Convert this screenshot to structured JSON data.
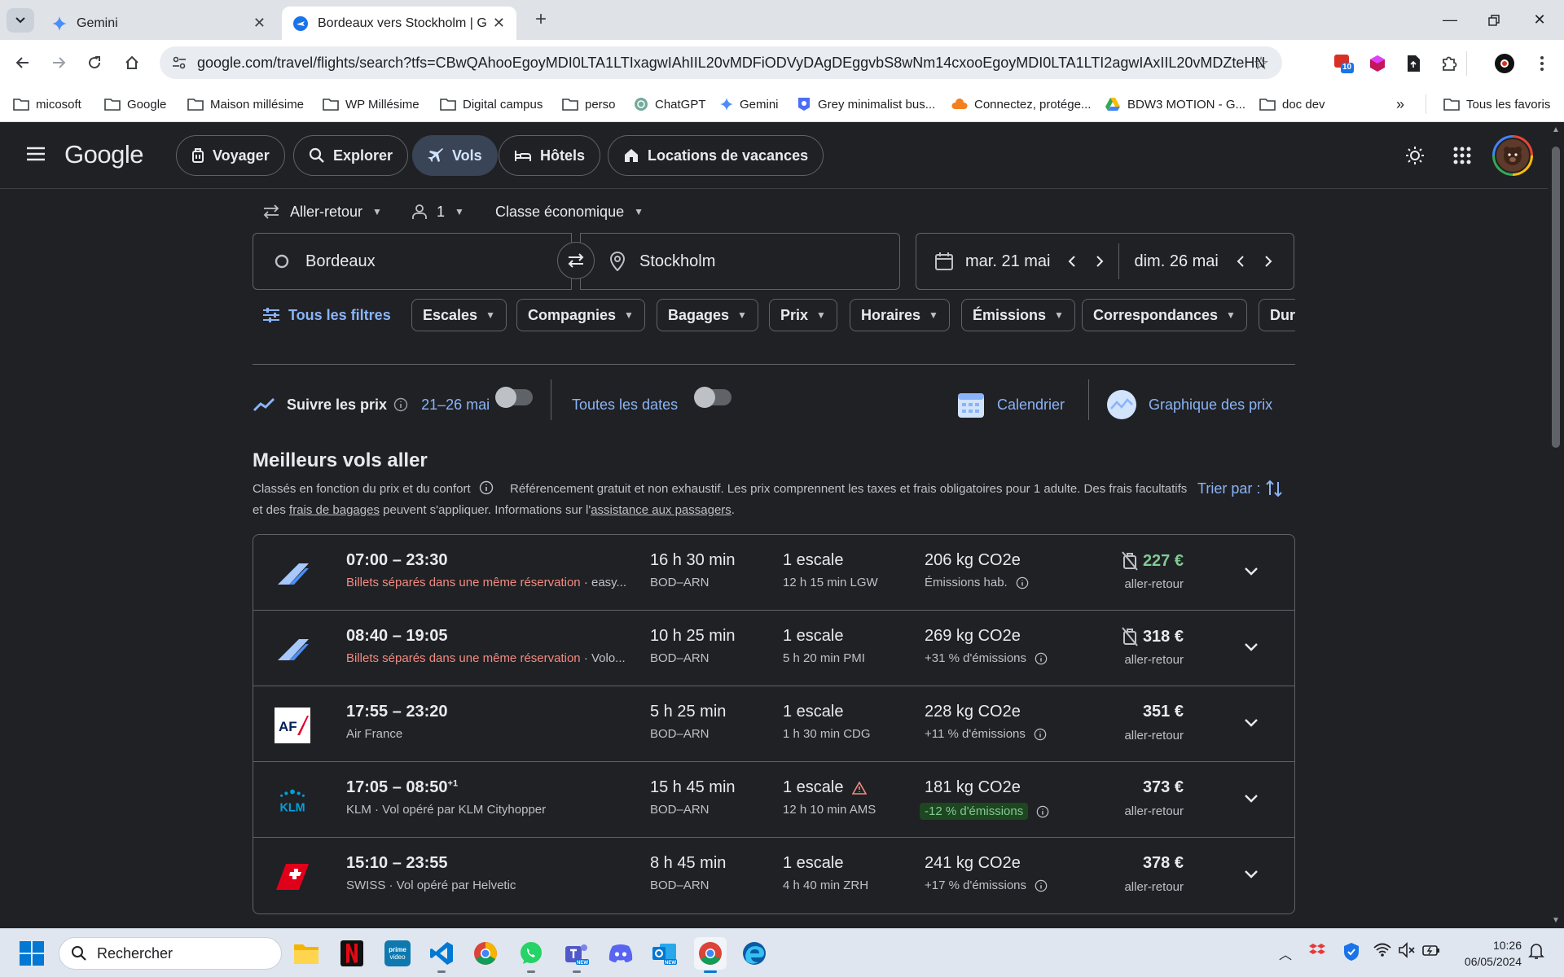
{
  "browser": {
    "tabs": [
      {
        "title": "Gemini",
        "active": false
      },
      {
        "title": "Bordeaux vers Stockholm | Goo",
        "active": true
      }
    ],
    "url": "google.com/travel/flights/search?tfs=CBwQAhooEgoyMDI0LTA1LTIxagwIAhIIL20vMDFiODVyDAgDEggvbS8wNm14cxooEgoyMDI0LTA1LTI2agwIAxIIL20vMDZteHNyDAgCE...",
    "extension_badge": "10",
    "bookmarks": [
      "micosoft",
      "Google",
      "Maison millésime",
      "WP Millésime",
      "Digital campus",
      "perso",
      "ChatGPT",
      "Gemini",
      "Grey minimalist bus...",
      "Connectez, protége...",
      "BDW3 MOTION - G...",
      "doc dev"
    ],
    "all_bookmarks": "Tous les favoris"
  },
  "header": {
    "logo": "Google",
    "nav": [
      "Voyager",
      "Explorer",
      "Vols",
      "Hôtels",
      "Locations de vacances"
    ],
    "active_nav": "Vols"
  },
  "search": {
    "trip_type": "Aller-retour",
    "passengers": "1",
    "cabin_class": "Classe économique",
    "origin": "Bordeaux",
    "destination": "Stockholm",
    "depart_date": "mar. 21 mai",
    "return_date": "dim. 26 mai"
  },
  "filters": {
    "all": "Tous les filtres",
    "chips": [
      "Escales",
      "Compagnies",
      "Bagages",
      "Prix",
      "Horaires",
      "Émissions",
      "Correspondances",
      "Duré"
    ]
  },
  "tracking": {
    "label": "Suivre les prix",
    "dates": "21–26 mai",
    "all_dates": "Toutes les dates",
    "calendar": "Calendrier",
    "price_graph": "Graphique des prix"
  },
  "results": {
    "title": "Meilleurs vols aller",
    "subtitle_ranked": "Classés en fonction du prix et du confort",
    "subtitle_text": "Référencement gratuit et non exhaustif. Les prix comprennent les taxes et frais obligatoires pour 1 adulte. Des frais facultatifs et des",
    "link_baggage": "frais de bagages",
    "subtitle_mid": "peuvent s'appliquer. Informations sur l'",
    "link_assistance": "assistance aux passagers",
    "subtitle_end": ".",
    "sort_label": "Trier par :",
    "flights": [
      {
        "times": "07:00 – 23:30",
        "plus_day": "",
        "airline_warn": "Billets séparés dans une même réservation",
        "airline": " · easy...",
        "duration": "16 h 30 min",
        "route": "BOD–ARN",
        "stops": "1 escale",
        "stop_warning": false,
        "layover": "12 h 15 min LGW",
        "co2": "206 kg CO2e",
        "emissions": "Émissions hab.",
        "emissions_badge": false,
        "price": "227 €",
        "price_green": true,
        "no_bag_icon": true,
        "price_type": "aller-retour",
        "logo": "plane-tail"
      },
      {
        "times": "08:40 – 19:05",
        "plus_day": "",
        "airline_warn": "Billets séparés dans une même réservation",
        "airline": " · Volo...",
        "duration": "10 h 25 min",
        "route": "BOD–ARN",
        "stops": "1 escale",
        "stop_warning": false,
        "layover": "5 h 20 min PMI",
        "co2": "269 kg CO2e",
        "emissions": "+31 % d'émissions",
        "emissions_badge": false,
        "price": "318 €",
        "price_green": false,
        "no_bag_icon": true,
        "price_type": "aller-retour",
        "logo": "plane-tail"
      },
      {
        "times": "17:55 – 23:20",
        "plus_day": "",
        "airline_warn": "",
        "airline": "Air France",
        "duration": "5 h 25 min",
        "route": "BOD–ARN",
        "stops": "1 escale",
        "stop_warning": false,
        "layover": "1 h 30 min CDG",
        "co2": "228 kg CO2e",
        "emissions": "+11 % d'émissions",
        "emissions_badge": false,
        "price": "351 €",
        "price_green": false,
        "no_bag_icon": false,
        "price_type": "aller-retour",
        "logo": "af"
      },
      {
        "times": "17:05 – 08:50",
        "plus_day": "+1",
        "airline_warn": "",
        "airline": "KLM · Vol opéré par KLM Cityhopper",
        "duration": "15 h 45 min",
        "route": "BOD–ARN",
        "stops": "1 escale",
        "stop_warning": true,
        "layover": "12 h 10 min AMS",
        "co2": "181 kg CO2e",
        "emissions": "-12 % d'émissions",
        "emissions_badge": true,
        "price": "373 €",
        "price_green": false,
        "no_bag_icon": false,
        "price_type": "aller-retour",
        "logo": "klm"
      },
      {
        "times": "15:10 – 23:55",
        "plus_day": "",
        "airline_warn": "",
        "airline": "SWISS · Vol opéré par Helvetic",
        "duration": "8 h 45 min",
        "route": "BOD–ARN",
        "stops": "1 escale",
        "stop_warning": false,
        "layover": "4 h 40 min ZRH",
        "co2": "241 kg CO2e",
        "emissions": "+17 % d'émissions",
        "emissions_badge": false,
        "price": "378 €",
        "price_green": false,
        "no_bag_icon": false,
        "price_type": "aller-retour",
        "logo": "swiss"
      }
    ]
  },
  "taskbar": {
    "search_placeholder": "Rechercher",
    "time": "10:26",
    "date": "06/05/2024"
  },
  "colors": {
    "accent_blue": "#8ab4f8",
    "warning_red": "#f28b82",
    "green_price": "#81c995",
    "background": "#202124"
  }
}
